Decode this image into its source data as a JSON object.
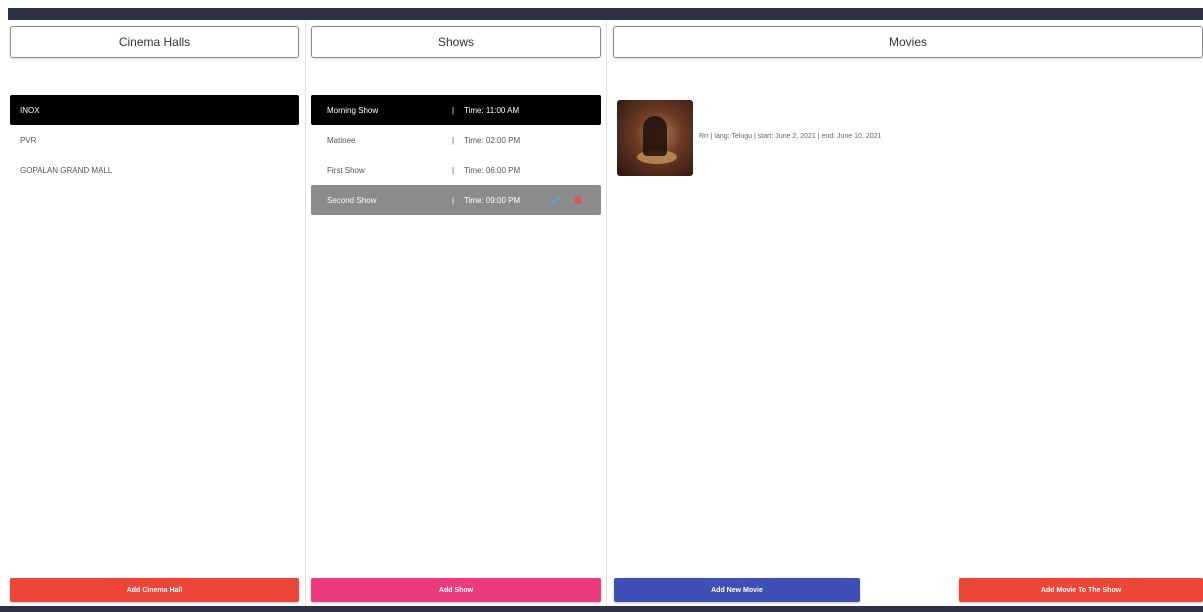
{
  "colors": {
    "top_bar": "#2d2f45",
    "selected_item": "#000000",
    "hover_item": "#8b8b8b",
    "add_hall_button": "#ec4638",
    "add_show_button": "#ec3a7e",
    "add_movie_button": "#3f4fb5",
    "add_movie_to_show_button": "#ec4638"
  },
  "halls": {
    "header": "Cinema Halls",
    "items": [
      {
        "label": "INOX"
      },
      {
        "label": "PVR"
      },
      {
        "label": "GOPALAN GRAND MALL"
      }
    ],
    "add_button": "Add Cinema Hall"
  },
  "shows": {
    "header": "Shows",
    "items": [
      {
        "name": "Morning Show",
        "sep": "|",
        "time": "Time: 11:00 AM"
      },
      {
        "name": "Matinee",
        "sep": "|",
        "time": "Time: 02:00 PM"
      },
      {
        "name": "First Show",
        "sep": "|",
        "time": "Time: 06:00 PM"
      },
      {
        "name": "Second Show",
        "sep": "|",
        "time": "Time: 09:00 PM",
        "icons": [
          "edit-icon",
          "delete-icon"
        ]
      }
    ],
    "add_button": "Add Show"
  },
  "movies": {
    "header": "Movies",
    "items": [
      {
        "info": "Rrr | lang: Telugu | start: June 2, 2021 | end: June 10, 2021"
      }
    ],
    "add_new_button": "Add New Movie",
    "add_to_show_button": "Add Movie To The Show"
  }
}
